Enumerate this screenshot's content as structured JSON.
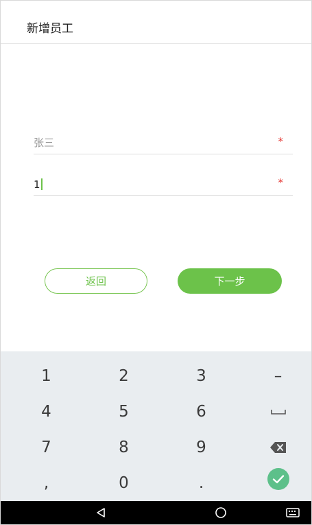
{
  "header": {
    "title": "新增员工"
  },
  "form": {
    "name_field": {
      "placeholder": "张三",
      "required_marker": "*"
    },
    "phone_field": {
      "value": "1",
      "required_marker": "*"
    }
  },
  "buttons": {
    "back_label": "返回",
    "next_label": "下一步"
  },
  "keyboard": {
    "keys": [
      "1",
      "2",
      "3",
      "–",
      "4",
      "5",
      "6",
      "space",
      "7",
      "8",
      "9",
      "backspace",
      ",",
      "0",
      ".",
      "done"
    ],
    "labels": {
      "k1": "1",
      "k2": "2",
      "k3": "3",
      "minus": "–",
      "k4": "4",
      "k5": "5",
      "k6": "6",
      "k7": "7",
      "k8": "8",
      "k9": "9",
      "comma": ",",
      "k0": "0",
      "period": "."
    },
    "done_color": "#5dc08a"
  },
  "navigation_bar": {
    "icons": [
      "back-triangle-icon",
      "home-circle-icon",
      "keyboard-icon"
    ]
  },
  "colors": {
    "accent": "#6cc24a",
    "required": "#e53935",
    "keyboard_bg": "#e9edf0"
  }
}
